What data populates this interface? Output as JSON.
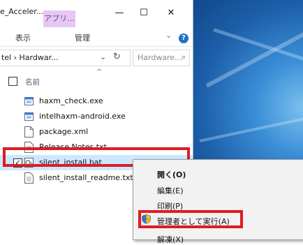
{
  "window": {
    "title": "e_Acceler...",
    "context_tab": "アプリ...",
    "controls": {
      "minimize": "—",
      "maximize": "☐",
      "close": "✕"
    }
  },
  "ribbon": {
    "tabs": [
      "表示",
      "管理"
    ],
    "help": "?"
  },
  "address": {
    "path": "tel › Hardwar...",
    "search_placeholder": "Hardware..."
  },
  "list": {
    "column_name": "名前",
    "files": [
      {
        "name": "haxm_check.exe",
        "icon": "exe-icon"
      },
      {
        "name": "intelhaxm-android.exe",
        "icon": "exe-icon"
      },
      {
        "name": "package.xml",
        "icon": "xml-file-icon"
      },
      {
        "name": "Release Notes.txt",
        "icon": "txt-file-icon"
      },
      {
        "name": "silent_install.bat",
        "icon": "bat-file-icon",
        "selected": true
      },
      {
        "name": "silent_install_readme.txt",
        "icon": "txt-file-icon"
      }
    ]
  },
  "context_menu": {
    "items": [
      {
        "label": "開く(O)",
        "default": true
      },
      {
        "label": "編集(E)"
      },
      {
        "label": "印刷(P)"
      },
      {
        "label": "管理者として実行(A)",
        "icon": "uac-shield-icon",
        "highlighted": true
      },
      {
        "label": "解凍(X)"
      }
    ]
  },
  "colors": {
    "selection": "#cce8ff",
    "highlight_border": "#e01b24",
    "context_tab": "#e6c7f5"
  }
}
